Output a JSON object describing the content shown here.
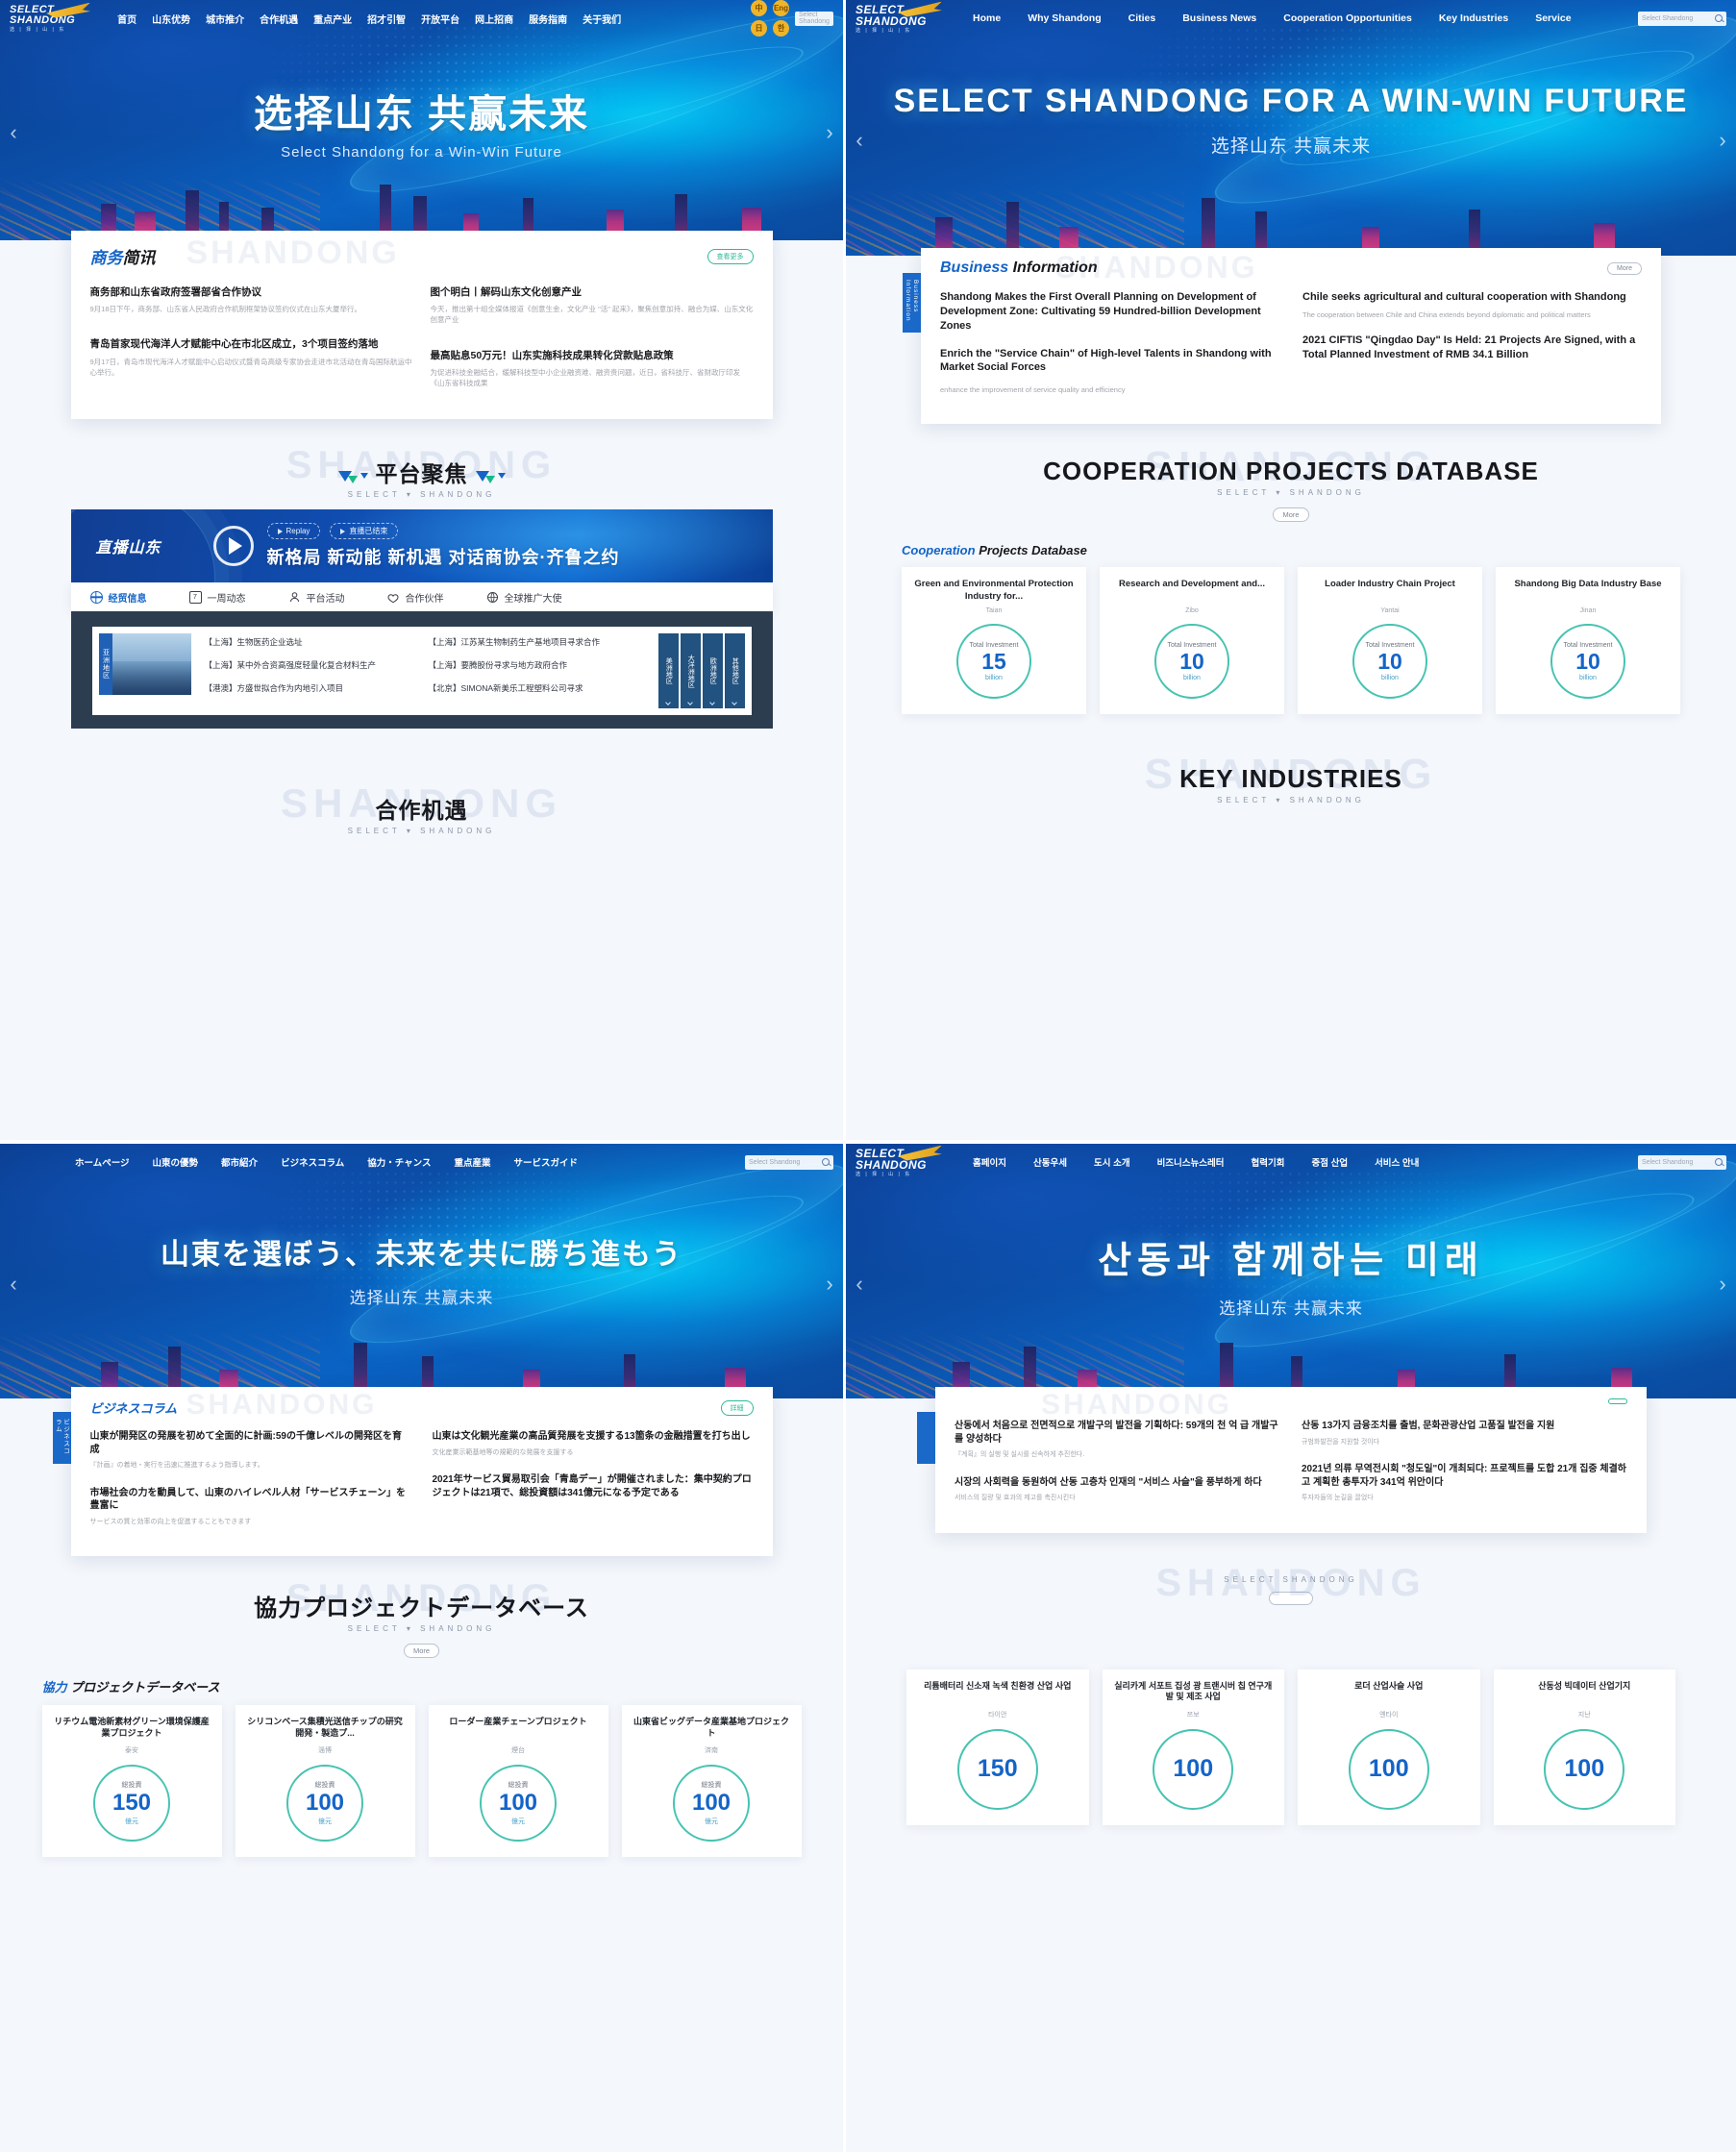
{
  "colors": {
    "brand": "#1464c8",
    "accent": "#2fb89a",
    "gold": "#f0b429",
    "dark": "#2d3d50"
  },
  "logo": {
    "line1": "SELECT",
    "line2": "SHANDONG",
    "line3": "选 | 择 | 山 | 东"
  },
  "panels": {
    "zh": {
      "lang": "zh",
      "nav": [
        "首页",
        "山东优势",
        "城市推介",
        "合作机遇",
        "重点产业",
        "招才引智",
        "开放平台",
        "网上招商",
        "服务指南",
        "关于我们"
      ],
      "lang_dots": [
        "中",
        "Eng",
        "日",
        "한"
      ],
      "search_placeholder": "Select Shandong",
      "hero_title": "选择山东  共赢未来",
      "hero_sub": "Select Shandong for a Win-Win Future",
      "news_tab": "商务简讯",
      "news_title_a": "商务",
      "news_title_b": "简讯",
      "news_more": "查看更多",
      "watermark": "SHANDONG",
      "news": [
        {
          "title": "商务部和山东省政府签署部省合作协议",
          "desc": "9月18日下午，商务部、山东省人民政府合作机制框架协议签约仪式在山东大厦举行。"
        },
        {
          "title": "图个明白丨解码山东文化创意产业",
          "desc": "今天，推出第十组全媒体报道《创意生金，文化产业 \"活\" 起来》，聚焦创意加持、融合为媒、山东文化创意产业"
        },
        {
          "title": "青岛首家现代海洋人才赋能中心在市北区成立，3个项目签约落地",
          "desc": "9月17日，青岛市现代海洋人才赋能中心启动仪式暨青岛高级专家协会走进市北活动在青岛国际航运中心举行。"
        },
        {
          "title": "最高贴息50万元！山东实施科技成果转化贷款贴息政策",
          "desc": "为促进科技金融结合，缓解科技型中小企业融资难、融资贵问题，近日，省科技厅、省财政厅印发《山东省科技成果"
        }
      ],
      "section_focus": "平台聚焦",
      "section_focus_sub": "SELECT ▾ SHANDONG",
      "section_focus_ghost": "SHANDONG",
      "live_label": "直播山东",
      "live_pill_1": "Replay",
      "live_pill_2": "直播已结束",
      "live_headline": "新格局 新动能 新机遇 对话商协会·齐鲁之约",
      "tabs": [
        {
          "label": "经贸信息",
          "icon": "globe-icon",
          "active": true
        },
        {
          "label": "一周动态",
          "icon": "calendar-icon",
          "active": false
        },
        {
          "label": "平台活动",
          "icon": "user-icon",
          "active": false
        },
        {
          "label": "合作伙伴",
          "icon": "handshake-icon",
          "active": false
        },
        {
          "label": "全球推广大使",
          "icon": "flag-icon",
          "active": false
        }
      ],
      "thumb_tag": "亚洲地区",
      "list_left": [
        "【上海】生物医药企业选址",
        "【上海】某中外合资高强度轻量化复合材料生产",
        "【港澳】方盛世拟合作为内地引入项目"
      ],
      "list_right": [
        "【上海】江苏某生物制药生产基地项目寻求合作",
        "【上海】要腾股份寻求与地方政府合作",
        "【北京】SIMONA新美乐工程塑料公司寻求"
      ],
      "region_tabs": [
        "美洲地区",
        "大洋洲地区",
        "欧洲地区",
        "其他地区"
      ],
      "bottom_section": "合作机遇",
      "bottom_section_sub": "SELECT ▾ SHANDONG",
      "bottom_ghost": "SHANDONG"
    },
    "en": {
      "lang": "en",
      "nav": [
        "Home",
        "Why Shandong",
        "Cities",
        "Business News",
        "Cooperation Opportunities",
        "Key Industries",
        "Service"
      ],
      "search_placeholder": "Select Shandong",
      "hero_title": "SELECT SHANDONG FOR A WIN-WIN FUTURE",
      "hero_sub": "选择山东 共赢未来",
      "news_tab": "Business Information",
      "news_title_a": "Business",
      "news_title_b": "Information",
      "news_more": "More",
      "watermark": "SHANDONG",
      "news": [
        {
          "title": "Shandong Makes the First Overall Planning on Development of Development Zone: Cultivating 59 Hundred-billion Development Zones",
          "desc": ""
        },
        {
          "title": "Chile seeks agricultural and cultural cooperation with Shandong",
          "desc": "The cooperation between Chile and China extends beyond diplomatic and political matters"
        },
        {
          "title": "Enrich the \"Service Chain\" of High-level Talents in Shandong with Market Social Forces",
          "desc": "enhance the improvement of service quality and efficiency"
        },
        {
          "title": "2021 CIFTIS \"Qingdao Day\" Is Held: 21 Projects Are Signed, with a Total Planned Investment of RMB 34.1 Billion",
          "desc": ""
        }
      ],
      "section_db": "COOPERATION PROJECTS DATABASE",
      "section_db_sub": "SELECT ▾ SHANDONG",
      "section_db_ghost": "SHANDONG",
      "db_more": "More",
      "db_title_a": "Cooperation",
      "db_title_b": "Projects Database",
      "projects": [
        {
          "name": "Green and Environmental Protection Industry for...",
          "city": "Taian",
          "label": "Total Investment",
          "value": "15",
          "unit": "billion"
        },
        {
          "name": "Research and Development and...",
          "city": "Zibo",
          "label": "Total Investment",
          "value": "10",
          "unit": "billion"
        },
        {
          "name": "Loader Industry Chain Project",
          "city": "Yantai",
          "label": "Total Investment",
          "value": "10",
          "unit": "billion"
        },
        {
          "name": "Shandong Big Data Industry Base",
          "city": "Jinan",
          "label": "Total Investment",
          "value": "10",
          "unit": "billion"
        }
      ],
      "bottom_section": "KEY INDUSTRIES",
      "bottom_section_sub": "SELECT ▾ SHANDONG",
      "bottom_ghost": "SHANDONG"
    },
    "ja": {
      "lang": "ja",
      "nav": [
        "ホームページ",
        "山東の優勢",
        "都市紹介",
        "ビジネスコラム",
        "協力・チャンス",
        "重点産業",
        "サービスガイド"
      ],
      "search_placeholder": "Select Shandong",
      "hero_title": "山東を選ぼう、未来を共に勝ち進もう",
      "hero_sub": "选择山东 共赢未来",
      "news_tab": "ビジネスコラム",
      "news_title_a": "ビジネスコラム",
      "news_title_b": "",
      "news_more": "詳細",
      "watermark": "SHANDONG",
      "news": [
        {
          "title": "山東が開発区の発展を初めて全面的に計画:59の千億レベルの開発区を育成",
          "desc": "『計画』の着地・実行を迅速に推進するよう指導します。"
        },
        {
          "title": "山東は文化観光産業の高品質発展を支援する13箇条の金融措置を打ち出し",
          "desc": "文化産業示範基地等の規範的な発展を支援する"
        },
        {
          "title": "市場社会の力を動員して、山東のハイレベル人材「サービスチェーン」を豊富に",
          "desc": "サービスの質と効率の向上を促進することもできます"
        },
        {
          "title": "2021年サービス貿易取引会「青島デー」が開催されました：集中契約プロジェクトは21項で、総投資額は341億元になる予定である",
          "desc": ""
        }
      ],
      "section_db": "協力プロジェクトデータベース",
      "section_db_sub": "SELECT ▾ SHANDONG",
      "section_db_ghost": "SHANDONG",
      "db_more": "More",
      "db_title_a": "協力",
      "db_title_b": "プロジェクトデータベース",
      "projects": [
        {
          "name": "リチウム電池新素材グリーン環境保護産業プロジェクト",
          "city": "泰安",
          "label": "総投資",
          "value": "150",
          "unit": "億元"
        },
        {
          "name": "シリコンベース集積光送信チップの研究開発・製造プ...",
          "city": "淄博",
          "label": "総投資",
          "value": "100",
          "unit": "億元"
        },
        {
          "name": "ローダー産業チェーンプロジェクト",
          "city": "煙台",
          "label": "総投資",
          "value": "100",
          "unit": "億元"
        },
        {
          "name": "山東省ビッグデータ産業基地プロジェクト",
          "city": "済南",
          "label": "総投資",
          "value": "100",
          "unit": "億元"
        }
      ]
    },
    "ko": {
      "lang": "ko",
      "nav": [
        "홈페이지",
        "산동우세",
        "도시 소개",
        "비즈니스뉴스레터",
        "협력기회",
        "중점 산업",
        "서비스 안내"
      ],
      "search_placeholder": "Select Shandong",
      "hero_title": "산동과 함께하는 미래",
      "hero_sub": "选择山东 共赢未来",
      "news_tab": "",
      "news_title_a": "",
      "news_title_b": "",
      "news_more": "",
      "watermark": "SHANDONG",
      "news": [
        {
          "title": "산동에서 처음으로 전면적으로 개발구의 발전을 기획하다: 59개의 천 억 급 개발구를 양성하다",
          "desc": "『계획』의 실행 및 실시를 신속하게 추진한다."
        },
        {
          "title": "산동 13가지 금융조치를 출범, 문화관광산업 고품질 발전을 지원",
          "desc": "규범화발전을 지원할 것이다"
        },
        {
          "title": "시장의 사회력을 동원하여 산동 고층차 인재의 \"서비스 사슬\"을 풍부하게 하다",
          "desc": "서비스의 질량 및 효과의 제고를 촉진시킨다"
        },
        {
          "title": "2021년 의류 무역전시회 \"청도일\"이 개최되다: 프로젝트를 도합 21개 집중 체결하고 계획한 총투자가 341억 위안이다",
          "desc": "투자자들의 눈길을 끌었다"
        }
      ],
      "section_db": "",
      "section_db_sub": "SELECT   SHANDONG",
      "section_db_ghost": "SHANDONG",
      "db_more": "",
      "db_title_a": "",
      "db_title_b": "",
      "projects": [
        {
          "name": "리튬배터리 신소재 녹색 친환경 산업 사업",
          "city": "타이안",
          "label": "",
          "value": "150",
          "unit": ""
        },
        {
          "name": "실리카게 서포트 집성 광 트랜시버 칩 연구개발 및 제조 사업",
          "city": "쯔보",
          "label": "",
          "value": "100",
          "unit": ""
        },
        {
          "name": "로더 산업사슬 사업",
          "city": "옌타이",
          "label": "",
          "value": "100",
          "unit": ""
        },
        {
          "name": "산동성 빅데이터 산업기지",
          "city": "지난",
          "label": "",
          "value": "100",
          "unit": ""
        }
      ]
    }
  }
}
